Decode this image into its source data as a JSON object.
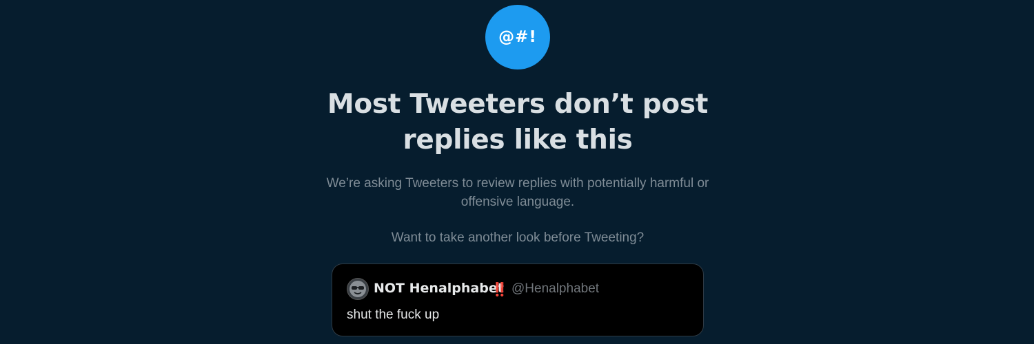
{
  "header": {
    "badge_text": "@#!",
    "title": "Most Tweeters don’t post replies like this",
    "description": "We’re asking Tweeters to review replies with potentially harmful or offensive language.",
    "question": "Want to take another look before Tweeting?"
  },
  "reply": {
    "author_name": "NOT Henalphabet",
    "author_emoji": "‼️",
    "author_handle": "@Henalphabet",
    "text": "shut the fuck up",
    "avatar_icon": "avatar-icon"
  },
  "colors": {
    "background": "#061d2e",
    "accent": "#1d9bf0",
    "card": "#000000"
  }
}
